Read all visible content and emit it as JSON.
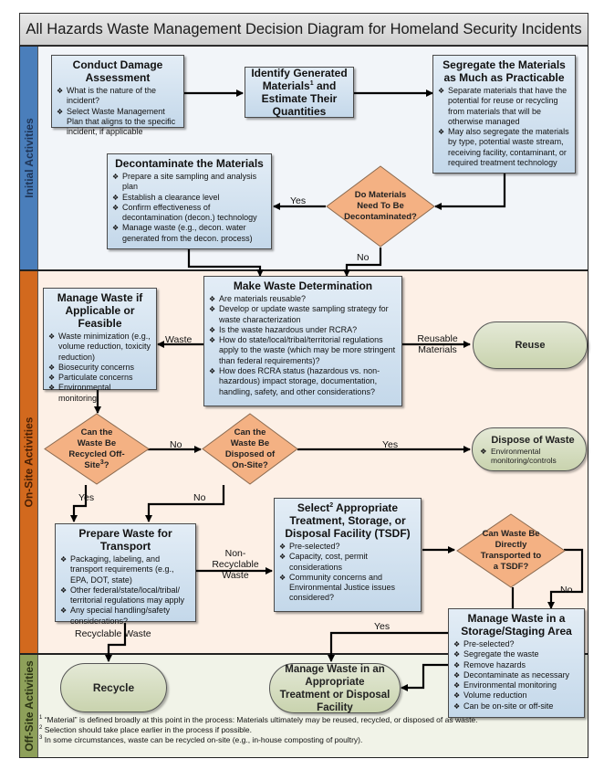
{
  "title": "All Hazards Waste Management Decision Diagram for Homeland Security Incidents",
  "colors": {
    "initial_lane": "#4a7ebb",
    "onsite_lane": "#d2691e",
    "offsite_lane": "#8ea05a",
    "process_box": "#c4d8ea",
    "decision_diamond": "#f4b183",
    "terminal": "#c9d3ae"
  },
  "lanes": {
    "initial": "Initial Activities",
    "onsite": "On-Site Activities",
    "offsite": "Off-Site Activities"
  },
  "nodes": {
    "damage_assessment": {
      "title": "Conduct Damage Assessment",
      "bullets": [
        "What is the nature of the incident?",
        "Select Waste Management Plan that aligns to the specific incident, if applicable"
      ]
    },
    "identify_materials": {
      "title_pre": "Identify Generated Materials",
      "title_sup": "1",
      "title_post": " and Estimate Their Quantities"
    },
    "segregate": {
      "title": "Segregate the Materials as Much as Practicable",
      "bullets": [
        "Separate materials that have the potential for reuse or recycling from materials that will be otherwise managed",
        "May also segregate the materials by type, potential waste stream, receiving facility, contaminant, or required treatment technology"
      ]
    },
    "decontaminate": {
      "title": "Decontaminate the Materials",
      "bullets": [
        "Prepare a site sampling and analysis plan",
        "Establish a clearance level",
        "Confirm effectiveness of decontamination (decon.) technology",
        "Manage waste (e.g., decon. water generated from the decon. process)"
      ]
    },
    "need_decon": {
      "text": "Do Materials Need To Be Decontaminated?"
    },
    "waste_determination": {
      "title": "Make Waste Determination",
      "bullets": [
        "Are materials reusable?",
        "Develop or update waste sampling strategy for waste characterization",
        "Is the waste hazardous under RCRA?",
        "How do state/local/tribal/territorial regulations apply to the waste (which may be more stringent than federal requirements)?",
        "How does RCRA status (hazardous vs. non-hazardous) impact storage, documentation, handling, safety, and other considerations?"
      ]
    },
    "manage_if_feasible": {
      "title": "Manage Waste if Applicable or Feasible",
      "bullets": [
        "Waste minimization (e.g., volume reduction, toxicity reduction)",
        "Biosecurity concerns",
        "Particulate concerns",
        "Environmental monitoring"
      ]
    },
    "reuse": {
      "text": "Reuse"
    },
    "recycle_offsite": {
      "text_pre": "Can the Waste Be Recycled Off-Site",
      "text_sup": "3",
      "text_post": "?"
    },
    "dispose_onsite": {
      "text": "Can the Waste Be Disposed of On-Site?"
    },
    "dispose_of_waste": {
      "title": "Dispose of Waste",
      "bullets": [
        "Environmental monitoring/controls"
      ]
    },
    "prepare_transport": {
      "title": "Prepare Waste for Transport",
      "bullets": [
        "Packaging, labeling, and transport requirements (e.g., EPA, DOT, state)",
        "Other federal/state/local/tribal/ territorial regulations may apply",
        "Any special handling/safety considerations?"
      ]
    },
    "select_tsdf": {
      "title_pre": "Select",
      "title_sup": "2",
      "title_post": " Appropriate Treatment, Storage, or Disposal Facility (TSDF)",
      "bullets": [
        "Pre-selected?",
        "Capacity, cost, permit considerations",
        "Community concerns and Environmental Justice issues considered?"
      ]
    },
    "direct_transport": {
      "text": "Can Waste Be Directly Transported to a TSDF?"
    },
    "storage_staging": {
      "title": "Manage Waste in a Storage/Staging Area",
      "bullets": [
        "Pre-selected?",
        "Segregate the waste",
        "Remove hazards",
        "Decontaminate as necessary",
        "Environmental monitoring",
        "Volume reduction",
        "Can be on-site or off-site"
      ]
    },
    "recycle": {
      "text": "Recycle"
    },
    "treatment_facility": {
      "text": "Manage Waste in an Appropriate Treatment or Disposal Facility"
    }
  },
  "edge_labels": {
    "decon_yes": "Yes",
    "decon_no": "No",
    "waste": "Waste",
    "reusable_materials": "Reusable Materials",
    "recycle_no": "No",
    "dispose_yes": "Yes",
    "recycle_yes": "Yes",
    "dispose_no": "No",
    "non_recyclable_waste": "Non- Recyclable Waste",
    "recyclable_waste": "Recyclable Waste",
    "direct_yes": "Yes",
    "direct_no": "No"
  },
  "footnotes": [
    {
      "num": "1",
      "text": "“Material” is defined broadly at this point in the process: Materials ultimately may be reused, recycled, or disposed of as waste."
    },
    {
      "num": "2",
      "text": "Selection should take place earlier in the process if possible."
    },
    {
      "num": "3",
      "text": "In some circumstances, waste can be recycled on-site (e.g., in-house composting of poultry)."
    }
  ]
}
